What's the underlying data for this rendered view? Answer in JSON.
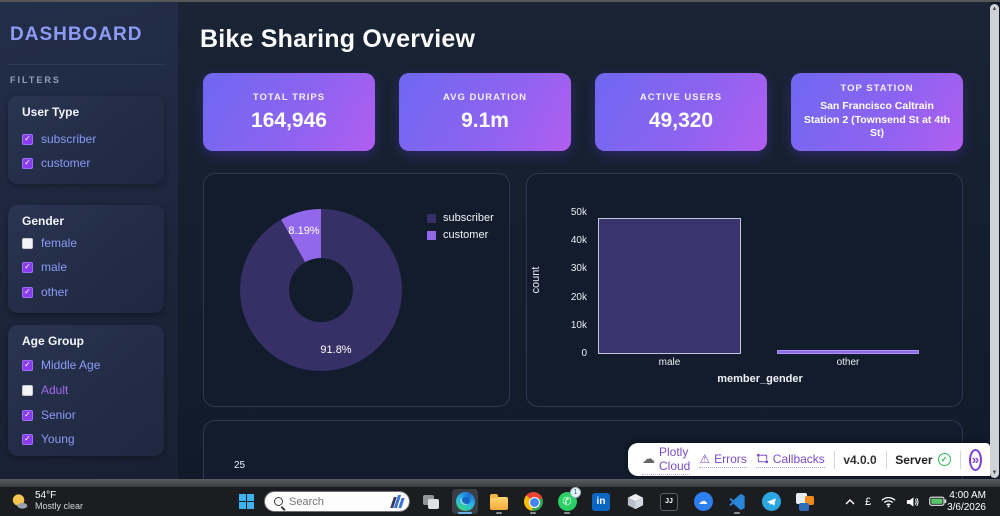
{
  "sidebar": {
    "title": "DASHBOARD",
    "filters_label": "FILTERS",
    "groups": [
      {
        "title": "User Type",
        "options": [
          {
            "label": "subscriber",
            "checked": true
          },
          {
            "label": "customer",
            "checked": true
          }
        ]
      },
      {
        "title": "Gender",
        "options": [
          {
            "label": "female",
            "checked": false
          },
          {
            "label": "male",
            "checked": true
          },
          {
            "label": "other",
            "checked": true
          }
        ]
      },
      {
        "title": "Age Group",
        "options": [
          {
            "label": "Middle Age",
            "checked": true
          },
          {
            "label": "Adult",
            "checked": false
          },
          {
            "label": "Senior",
            "checked": true
          },
          {
            "label": "Young",
            "checked": true
          }
        ]
      }
    ]
  },
  "header": {
    "title": "Bike Sharing Overview"
  },
  "kpis": [
    {
      "label": "TOTAL TRIPS",
      "value": "164,946"
    },
    {
      "label": "AVG DURATION",
      "value": "9.1m"
    },
    {
      "label": "ACTIVE USERS",
      "value": "49,320"
    },
    {
      "label": "TOP STATION",
      "value": "San Francisco Caltrain Station 2 (Townsend St at 4th St)"
    }
  ],
  "chart_data": [
    {
      "type": "pie",
      "labels": [
        "subscriber",
        "customer"
      ],
      "values": [
        91.81,
        8.19
      ],
      "value_labels": [
        "91.8%",
        "8.19%"
      ],
      "colors": [
        "#373067",
        "#9268ea"
      ],
      "hole": 0.4,
      "legend_position": "right"
    },
    {
      "type": "bar",
      "categories": [
        "male",
        "other"
      ],
      "values": [
        48200,
        1300
      ],
      "xlabel": "member_gender",
      "ylabel": "count",
      "ylim": [
        0,
        50000
      ],
      "yticks": [
        "0",
        "10k",
        "20k",
        "30k",
        "40k",
        "50k"
      ],
      "colors": [
        "#3a336e",
        "#9268ea"
      ],
      "grid": false
    },
    {
      "type": "line",
      "note": "partially visible chart",
      "yticks": [
        "25"
      ]
    }
  ],
  "devtools": {
    "plotly_cloud": "Plotly Cloud",
    "errors": "Errors",
    "callbacks": "Callbacks",
    "version": "v4.0.0",
    "server": "Server",
    "server_ok": "✓",
    "expand": "»"
  },
  "taskbar": {
    "weather": {
      "temp": "54°F",
      "condition": "Mostly clear"
    },
    "search": {
      "placeholder": "Search"
    },
    "whatsapp_badge": "1",
    "linkedin_glyph": "in",
    "tray": {
      "lang": "£"
    },
    "clock": {
      "time": "4:00 AM",
      "date": "3/6/2026"
    }
  }
}
